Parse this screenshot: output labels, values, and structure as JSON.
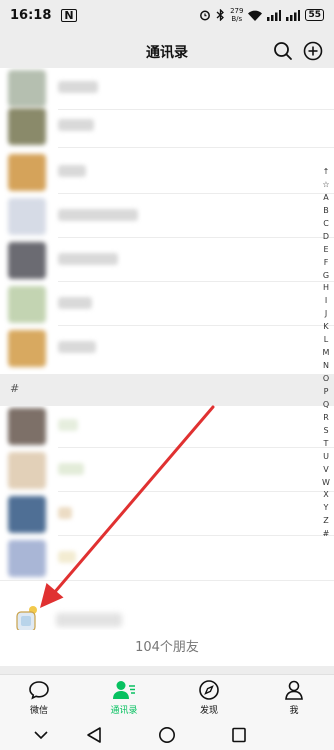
{
  "status_bar": {
    "time": "16:18",
    "nfc": "N",
    "net_speed_value": "279",
    "net_speed_unit": "B/s",
    "battery": "55"
  },
  "header": {
    "title": "通讯录",
    "icons": [
      "search-icon",
      "add-icon"
    ]
  },
  "contacts": {
    "section_header": "#",
    "avatar_colors": [
      "#b5bfb0",
      "#8a8a6a",
      "#d5a35a",
      "#d6dbe6",
      "#6b6b72",
      "#c3d4b2",
      "#d8a960",
      "#7d7068",
      "#e2d0b8",
      "#4f6f95",
      "#a9b6d6"
    ]
  },
  "footer": {
    "friend_count": "104个朋友"
  },
  "index_letters": [
    "↑",
    "☆",
    "A",
    "B",
    "C",
    "D",
    "E",
    "F",
    "G",
    "H",
    "I",
    "J",
    "K",
    "L",
    "M",
    "N",
    "O",
    "P",
    "Q",
    "R",
    "S",
    "T",
    "U",
    "V",
    "W",
    "X",
    "Y",
    "Z",
    "#"
  ],
  "tab_bar": {
    "tabs": [
      {
        "label": "微信",
        "icon": "chat-icon"
      },
      {
        "label": "通讯录",
        "icon": "contacts-icon"
      },
      {
        "label": "发现",
        "icon": "compass-icon"
      },
      {
        "label": "我",
        "icon": "person-icon"
      }
    ],
    "active": "通讯录",
    "accent_color": "#07c160"
  },
  "annotation_color": "#e03131"
}
